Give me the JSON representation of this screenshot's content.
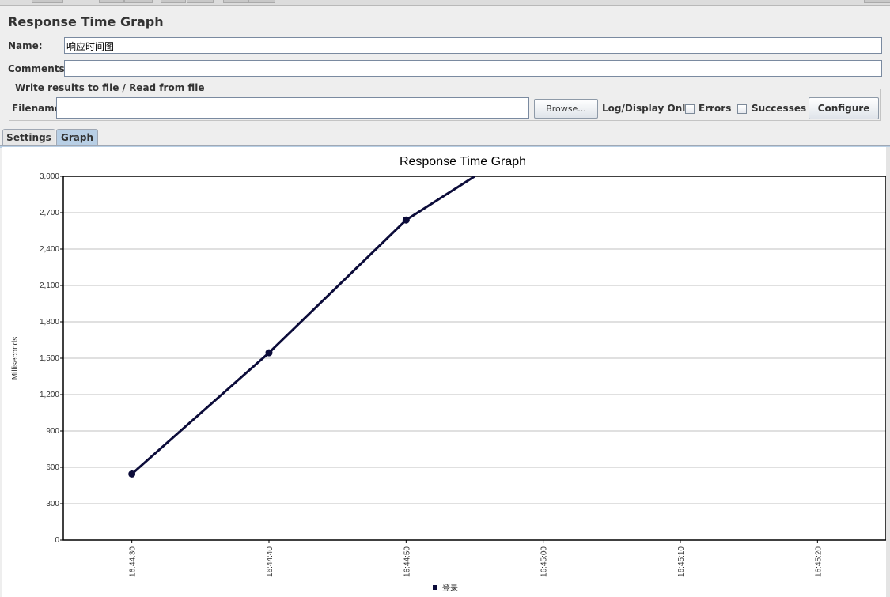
{
  "panel": {
    "title": "Response Time Graph"
  },
  "name_field": {
    "label": "Name:",
    "value": "响应时间图"
  },
  "comments_field": {
    "label": "Comments:",
    "value": ""
  },
  "file_section": {
    "legend": "Write results to file / Read from file",
    "filename_label": "Filename",
    "filename_value": "",
    "browse_label": "Browse...",
    "log_display_label": "Log/Display Only:",
    "errors_label": "Errors",
    "errors_checked": false,
    "successes_label": "Successes",
    "successes_checked": false,
    "configure_label": "Configure"
  },
  "tabs": [
    {
      "label": "Settings",
      "active": false
    },
    {
      "label": "Graph",
      "active": true
    }
  ],
  "icons": {
    "legend_marker": "square-icon"
  },
  "colors": {
    "series": "#0c0c3a",
    "gridline": "#c0c0c0",
    "tab_active": "#b8cfe5"
  },
  "chart_data": {
    "type": "line",
    "title": "Response Time Graph",
    "xlabel": "",
    "ylabel": "Milliseconds",
    "ylim": [
      0,
      3000
    ],
    "yticks": [
      0,
      300,
      600,
      900,
      1200,
      1500,
      1800,
      2100,
      2400,
      2700,
      3000
    ],
    "ytick_labels": [
      "0",
      "300",
      "600",
      "900",
      "1,200",
      "1,500",
      "1,800",
      "2,100",
      "2,400",
      "2,700",
      "3,000"
    ],
    "xticks": [
      "16:44:30",
      "16:44:40",
      "16:44:50",
      "16:45:00",
      "16:45:10",
      "16:45:20"
    ],
    "xlim": [
      "16:44:25",
      "16:45:25"
    ],
    "grid": true,
    "legend_placement": "bottom-center",
    "series": [
      {
        "name": "登录",
        "x": [
          "16:44:30",
          "16:44:40",
          "16:44:50",
          "16:44:55"
        ],
        "y": [
          545,
          1545,
          2640,
          3000
        ],
        "markers": [
          true,
          true,
          true,
          false
        ]
      }
    ]
  }
}
